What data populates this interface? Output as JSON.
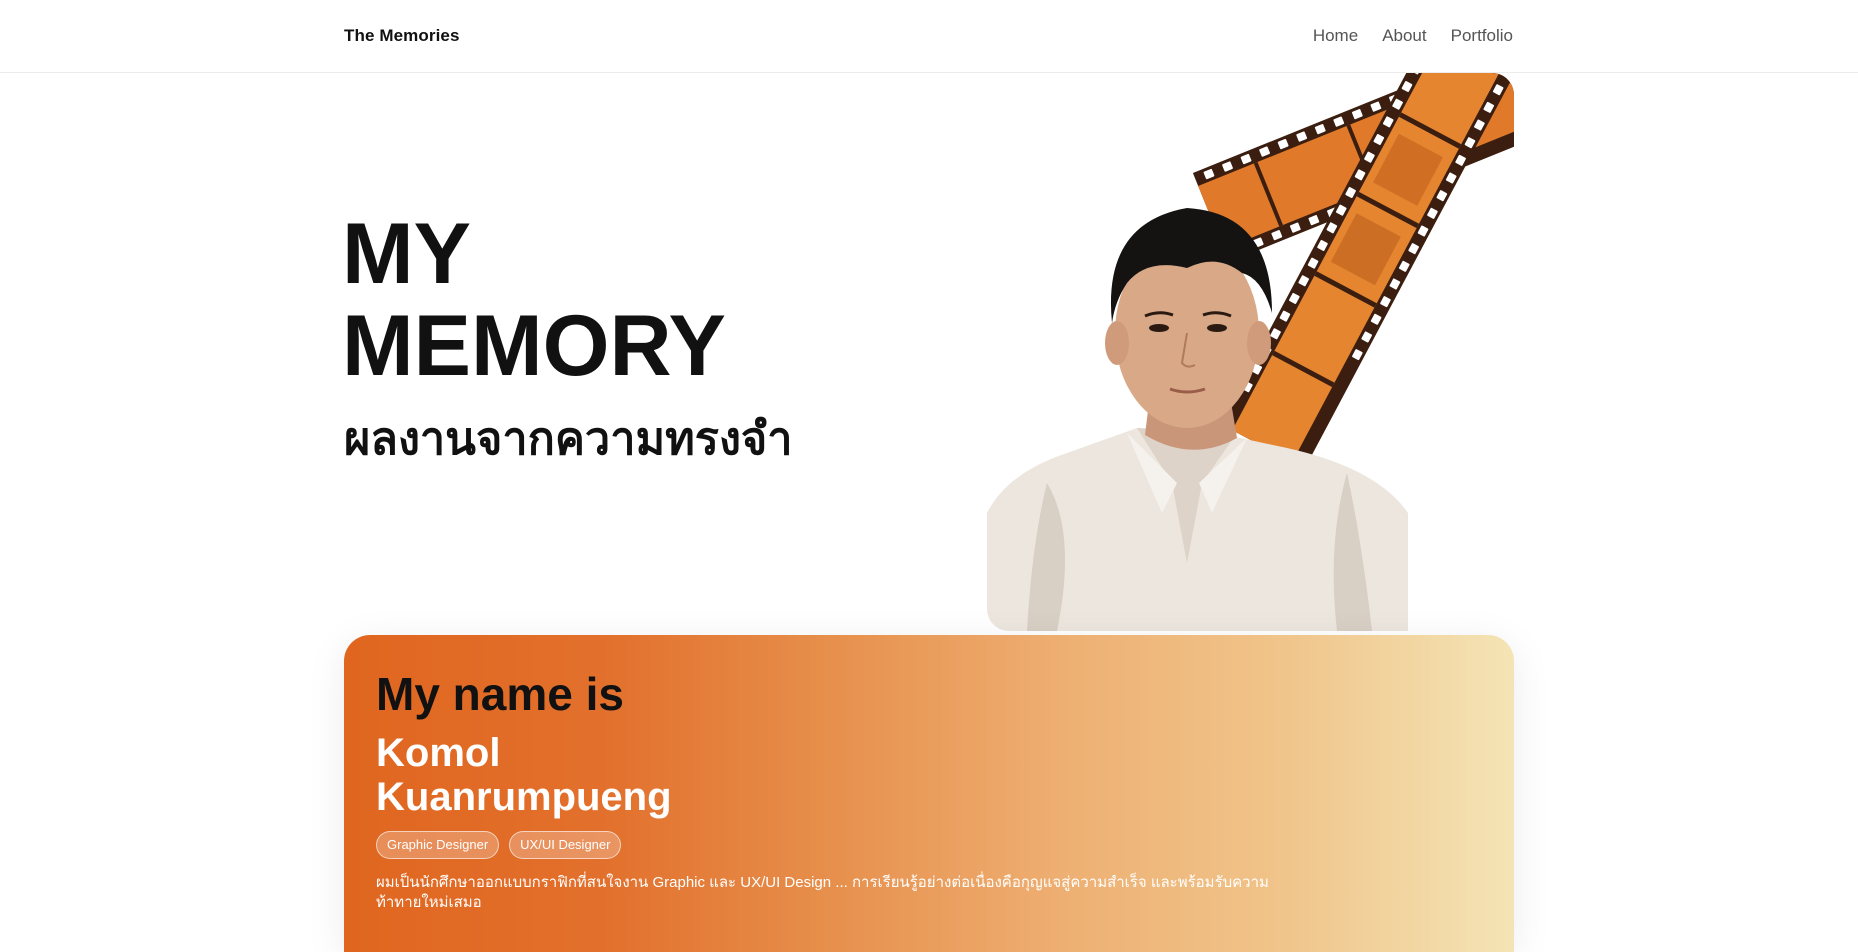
{
  "nav": {
    "brand": "The Memories",
    "links": [
      "Home",
      "About",
      "Portfolio"
    ]
  },
  "hero": {
    "title_line1": "MY",
    "title_line2": "MEMORY",
    "subtitle": "ผลงานจากความทรงจำ",
    "image_icon": "portrait-with-film-strip"
  },
  "card": {
    "heading": "My name is",
    "name_line1": "Komol",
    "name_line2": "Kuanrumpueng",
    "tags": [
      "Graphic Designer",
      "UX/UI Designer"
    ],
    "description": "ผมเป็นนักศึกษาออกแบบกราฟิกที่สนใจงาน Graphic และ UX/UI Design ... การเรียนรู้อย่างต่อเนื่องคือกุญแจสู่ความสำเร็จ และพร้อมรับความท้าทายใหม่เสมอ"
  },
  "colors": {
    "accent": "#e0661f",
    "gradient_end": "#f4e4b5",
    "film": "#e07a2a",
    "film_frame": "#3b1e10"
  }
}
